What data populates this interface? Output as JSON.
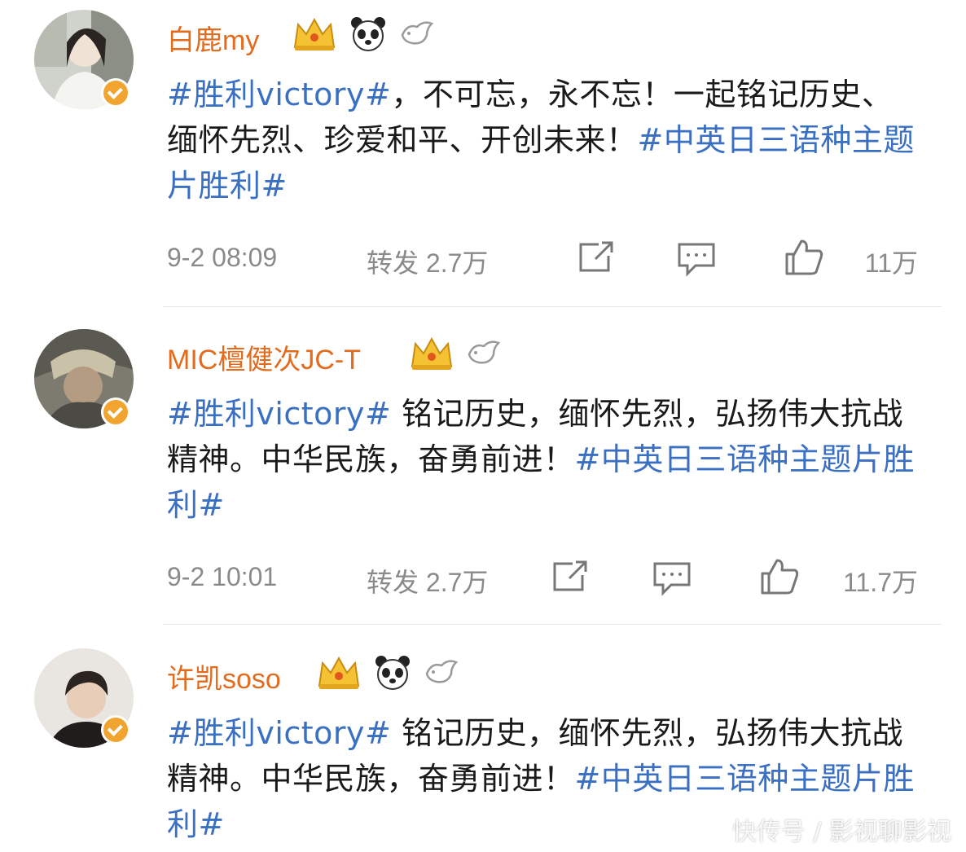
{
  "posts": [
    {
      "username": "白鹿my",
      "badges": [
        "crown-badge-icon",
        "panda-badge-icon",
        "bird-badge-icon"
      ],
      "text_segments": [
        {
          "text": "#胜利victory#",
          "tag": true
        },
        {
          "text": "，不可忘，永不忘！一起铭记历史、缅怀先烈、珍爱和平、开创未来！",
          "tag": false
        },
        {
          "text": "#中英日三语种主题片胜利#",
          "tag": true
        }
      ],
      "time": "9-2 08:09",
      "repost": "转发 2.7万",
      "likes": "11万"
    },
    {
      "username": "MIC檀健次JC-T",
      "badges": [
        "crown-badge-icon",
        "bird-badge-icon"
      ],
      "text_segments": [
        {
          "text": "#胜利victory#",
          "tag": true
        },
        {
          "text": " 铭记历史，缅怀先烈，弘扬伟大抗战精神。中华民族，奋勇前进！",
          "tag": false
        },
        {
          "text": "#中英日三语种主题片胜利#",
          "tag": true
        }
      ],
      "time": "9-2 10:01",
      "repost": "转发 2.7万",
      "likes": "11.7万"
    },
    {
      "username": "许凯soso",
      "badges": [
        "crown-badge-icon",
        "panda-badge-icon",
        "bird-badge-icon"
      ],
      "text_segments": [
        {
          "text": "#胜利victory#",
          "tag": true
        },
        {
          "text": " 铭记历史，缅怀先烈，弘扬伟大抗战精神。中华民族，奋勇前进！",
          "tag": false
        },
        {
          "text": "#中英日三语种主题片胜利#",
          "tag": true
        }
      ]
    }
  ],
  "watermark": "快传号 / 影视聊影视",
  "colors": {
    "username": "#e36b1e",
    "hashtag": "#3a6fc1",
    "meta": "#8a8a8a",
    "verified": "#f1a42f"
  }
}
